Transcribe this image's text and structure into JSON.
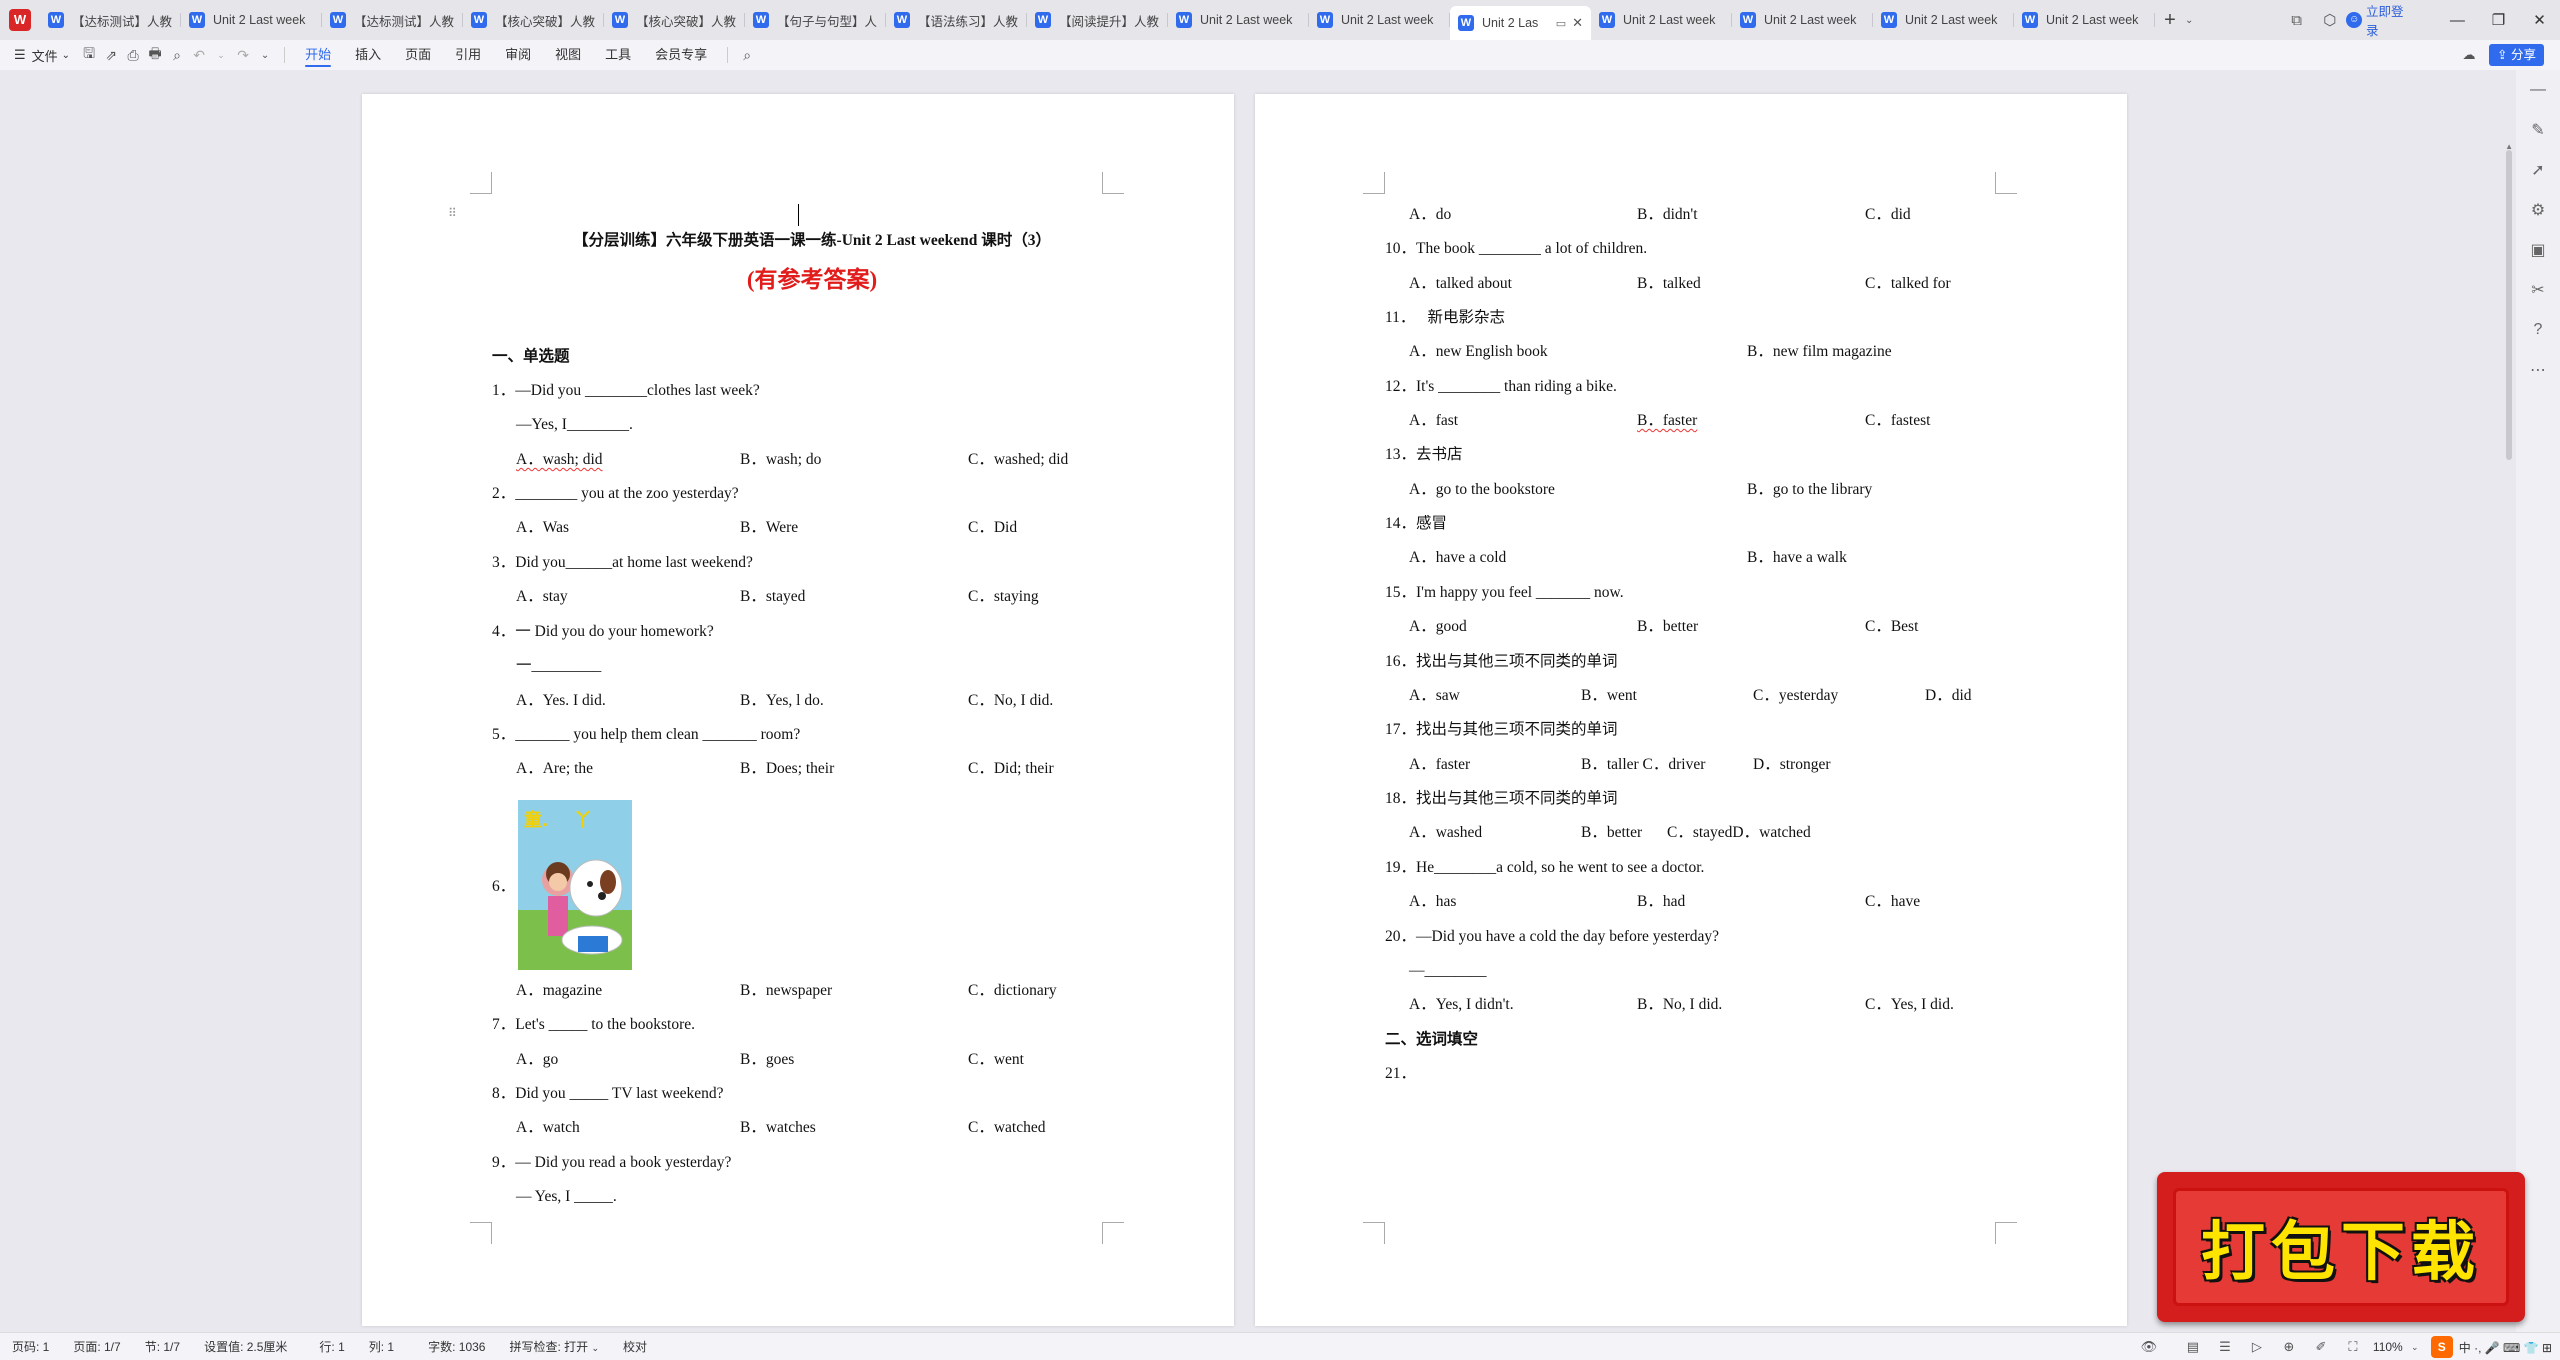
{
  "tabbar": {
    "tabs": [
      {
        "label": "【达标测试】人教"
      },
      {
        "label": "Unit 2 Last week"
      },
      {
        "label": "【达标测试】人教"
      },
      {
        "label": "【核心突破】人教"
      },
      {
        "label": "【核心突破】人教"
      },
      {
        "label": "【句子与句型】人"
      },
      {
        "label": "【语法练习】人教"
      },
      {
        "label": "【阅读提升】人教"
      },
      {
        "label": "Unit 2 Last week"
      },
      {
        "label": "Unit 2 Last week"
      },
      {
        "label": "Unit 2 Las"
      },
      {
        "label": "Unit 2 Last week"
      },
      {
        "label": "Unit 2 Last week"
      },
      {
        "label": "Unit 2 Last week"
      },
      {
        "label": "Unit 2 Last week"
      }
    ],
    "login_label": "立即登录"
  },
  "ribbon": {
    "file_label": "文件",
    "tabs": [
      {
        "label": "开始",
        "active": true
      },
      {
        "label": "插入"
      },
      {
        "label": "页面"
      },
      {
        "label": "引用"
      },
      {
        "label": "审阅"
      },
      {
        "label": "视图"
      },
      {
        "label": "工具"
      },
      {
        "label": "会员专享"
      }
    ],
    "share_label": "分享"
  },
  "page1": {
    "title": "【分层训练】六年级下册英语一课一练-Unit 2 Last weekend  课时（3）",
    "subtitle": "(有参考答案)",
    "section1": "一、单选题",
    "q1": {
      "num": "1．",
      "stem": "—Did you ________clothes last week?",
      "stem2": "—Yes, I________.",
      "a": "A．wash; did",
      "b": "B．wash; do",
      "c": "C．washed; did"
    },
    "q2": {
      "num": "2．",
      "stem": "________ you at the zoo yesterday?",
      "a": "A．Was",
      "b": "B．Were",
      "c": "C．Did"
    },
    "q3": {
      "num": "3．",
      "stem": "Did you______at home last weekend?",
      "a": "A．stay",
      "b": "B．stayed",
      "c": "C．staying"
    },
    "q4": {
      "num": "4．",
      "stem": "一 Did you do your homework?",
      "stem2": "一_________",
      "a": "A．Yes. I did.",
      "b": "B．Yes, l do.",
      "c": "C．No, I did."
    },
    "q5": {
      "num": "5．",
      "stem": "_______  you help them clean  _______  room?",
      "a": "A．Are; the",
      "b": "B．Does; their",
      "c": "C．Did; their"
    },
    "q6": {
      "num": "6．",
      "a": "A．magazine",
      "b": "B．newspaper",
      "c": "C．dictionary"
    },
    "q7": {
      "num": "7．",
      "stem": "Let's _____ to the bookstore.",
      "a": "A．go",
      "b": "B．goes",
      "c": "C．went"
    },
    "q8": {
      "num": "8．",
      "stem": "Did you _____ TV last weekend?",
      "a": "A．watch",
      "b": "B．watches",
      "c": "C．watched"
    },
    "q9": {
      "num": "9．",
      "stem": "— Did you read a book yesterday?",
      "stem2": "— Yes, I _____."
    }
  },
  "page2": {
    "q9opts": {
      "a": "A．do",
      "b": "B．didn't",
      "c": "C．did"
    },
    "q10": {
      "num": "10．",
      "stem": "The book ________ a lot of children.",
      "a": "A．talked about",
      "b": "B．talked",
      "c": "C．talked for"
    },
    "q11": {
      "num": "11．",
      "stem": "新电影杂志",
      "a": "A．new English book",
      "b": "B．new film magazine"
    },
    "q12": {
      "num": "12．",
      "stem": "It's ________ than riding a bike.",
      "a": "A．fast",
      "b": "B．faster",
      "c": "C．fastest"
    },
    "q13": {
      "num": "13．",
      "stem": "去书店",
      "a": "A．go to the bookstore",
      "b": "B．go to the library"
    },
    "q14": {
      "num": "14．",
      "stem": "感冒",
      "a": "A．have a cold",
      "b": "B．have a walk"
    },
    "q15": {
      "num": "15．",
      "stem": "I'm happy you feel _______ now.",
      "a": "A．good",
      "b": "B．better",
      "c": "C．Best"
    },
    "q16": {
      "num": "16．",
      "stem": "找出与其他三项不同类的单词",
      "a": "A．saw",
      "b": "B．went",
      "c": "C．yesterday",
      "d": "D．did"
    },
    "q17": {
      "num": "17．",
      "stem": "找出与其他三项不同类的单词",
      "a": "A．faster",
      "bc": "B．taller C．driver",
      "d": "D．stronger"
    },
    "q18": {
      "num": "18．",
      "stem": "找出与其他三项不同类的单词",
      "a": "A．washed",
      "b": "B．better",
      "cd": "C．stayedD．watched"
    },
    "q19": {
      "num": "19．",
      "stem": "He________a cold, so he went to see a doctor.",
      "a": "A．has",
      "b": "B．had",
      "c": "C．have"
    },
    "q20": {
      "num": "20．",
      "stem": "—Did you have a cold the day before yesterday?",
      "stem2": "—________",
      "a": "A．Yes, I didn't.",
      "b": "B．No, I did.",
      "c": "C．Yes, I did."
    },
    "section2": "二、选词填空",
    "q21": {
      "num": "21．"
    }
  },
  "statusbar": {
    "page_num": "页码: 1",
    "pages": "页面: 1/7",
    "section": "节: 1/7",
    "setting": "设置值: 2.5厘米",
    "row": "行: 1",
    "col": "列: 1",
    "words": "字数: 1036",
    "spell": "拼写检查: 打开",
    "proof": "校对",
    "zoom": "110%",
    "ime_chars": "中 ·, 🎤 ⌨ 👕 ⊞"
  },
  "banner": {
    "text": "打包下载"
  },
  "colors": {
    "accent": "#2f6bec",
    "answer_red": "#e21b1b",
    "banner_red": "#d41d1d",
    "banner_text": "#ffe400"
  }
}
